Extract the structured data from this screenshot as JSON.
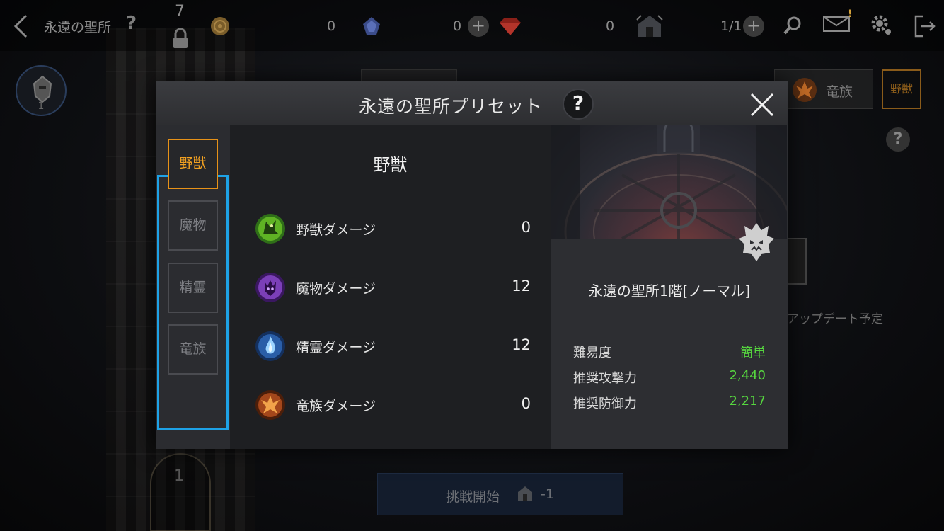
{
  "colors": {
    "accent_orange": "#e79218",
    "selection_blue": "#1ea2e6",
    "stat_green": "#56d63f"
  },
  "topbar": {
    "title": "永遠の聖所",
    "help": "?",
    "lock_count": "7",
    "currency": [
      {
        "icon": "gold-coin-icon",
        "value": "0"
      },
      {
        "icon": "blue-gem-icon",
        "value": "0"
      },
      {
        "icon": "red-gem-icon",
        "value": "0"
      },
      {
        "icon": "sanctuary-ticket-icon",
        "value": "1/1"
      }
    ]
  },
  "background": {
    "avatar_level": "1",
    "right_tab_label": "竜族",
    "beast_button": "野獣",
    "update_notice": "アップデート予定",
    "tower_floor": "1",
    "start_button": "挑戦開始",
    "start_cost": "-1",
    "help": "?"
  },
  "modal": {
    "title": "永遠の聖所プリセット",
    "help": "?",
    "tabs": [
      {
        "label": "野獣",
        "active": true
      },
      {
        "label": "魔物",
        "active": false
      },
      {
        "label": "精霊",
        "active": false
      },
      {
        "label": "竜族",
        "active": false
      }
    ],
    "section_title": "野獣",
    "stats": [
      {
        "icon": "beast-icon",
        "name": "野獣ダメージ",
        "value": "0"
      },
      {
        "icon": "monster-icon",
        "name": "魔物ダメージ",
        "value": "12"
      },
      {
        "icon": "spirit-icon",
        "name": "精霊ダメージ",
        "value": "12"
      },
      {
        "icon": "dragon-icon",
        "name": "竜族ダメージ",
        "value": "0"
      }
    ],
    "stage": {
      "title": "永遠の聖所1階[ノーマル]",
      "info": [
        {
          "key": "難易度",
          "value": "簡単"
        },
        {
          "key": "推奨攻撃力",
          "value": "2,440"
        },
        {
          "key": "推奨防御力",
          "value": "2,217"
        }
      ]
    }
  }
}
